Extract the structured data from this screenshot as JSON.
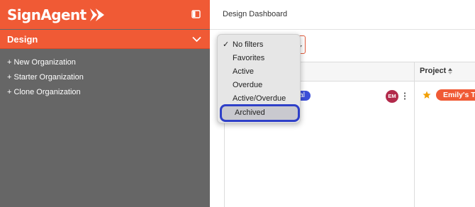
{
  "sidebar": {
    "brand": "SignAgent",
    "section_title": "Design",
    "menu": [
      "+ New Organization",
      "+ Starter Organization",
      "+ Clone Organization"
    ]
  },
  "header": {
    "title": "Design Dashboard"
  },
  "filters": {
    "selected": "No filters",
    "options": [
      {
        "label": "No filters",
        "checked": true
      },
      {
        "label": "Favorites",
        "checked": false
      },
      {
        "label": "Active",
        "checked": false
      },
      {
        "label": "Overdue",
        "checked": false
      },
      {
        "label": "Active/Overdue",
        "checked": false
      },
      {
        "label": "Archived",
        "checked": false,
        "highlighted": true
      }
    ]
  },
  "table": {
    "columns": {
      "project": "Project"
    },
    "row": {
      "status_partial": "ial",
      "assignee_initials": "EM",
      "project_name": "Emily's Te"
    }
  },
  "colors": {
    "brand": "#f05a35",
    "sidebar_bg": "#666666",
    "status_pill": "#3b4fd8",
    "avatar": "#b22a4b",
    "highlight_border": "#2f40c8",
    "star": "#f2a007"
  },
  "icons": {
    "logo": "signagent-logo-icon",
    "collapse": "sidebar-collapse-icon",
    "chevron": "chevron-down-icon",
    "checkmark": "checkmark-icon",
    "sort": "sort-arrows-icon",
    "star": "star-icon",
    "more": "more-vertical-icon"
  }
}
